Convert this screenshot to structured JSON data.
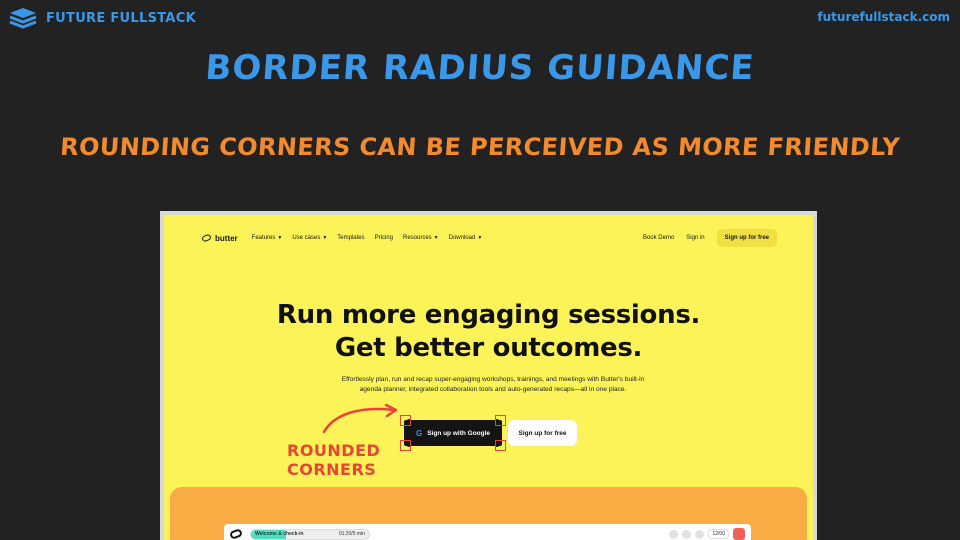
{
  "brand": {
    "name": "FUTURE FULLSTACK",
    "url": "futurefullstack.com"
  },
  "slide": {
    "title": "BORDER RADIUS GUIDANCE",
    "subtitle": "ROUNDING CORNERS CAN BE PERCEIVED AS MORE FRIENDLY",
    "annotation_line1": "ROUNDED",
    "annotation_line2": "CORNERS"
  },
  "colors": {
    "accent_blue": "#3b97e8",
    "accent_orange": "#f28a2e",
    "annotation_red": "#e8443a",
    "site_yellow": "#fbf358"
  },
  "site": {
    "logo": "butter",
    "nav": [
      "Features",
      "Use cases",
      "Templates",
      "Pricing",
      "Resources",
      "Download"
    ],
    "nav_dropdown": [
      true,
      true,
      false,
      false,
      true,
      true
    ],
    "book_demo": "Book Demo",
    "sign_in": "Sign in",
    "signup_free_nav": "Sign up for free",
    "hero_line1": "Run more engaging sessions.",
    "hero_line2": "Get better outcomes.",
    "description": "Effortlessly plan, run and recap super-engaging workshops, trainings, and meetings with Butter's built-in agenda planner, integrated collaboration tools and auto-generated recaps—all in one place.",
    "google_button": "Sign up with Google",
    "free_button": "Sign up for free",
    "app_bar": {
      "session_label": "Welcome & check-in",
      "session_time": "01:20/5 min",
      "session_progress": 0.3,
      "participants": "12/00"
    }
  }
}
